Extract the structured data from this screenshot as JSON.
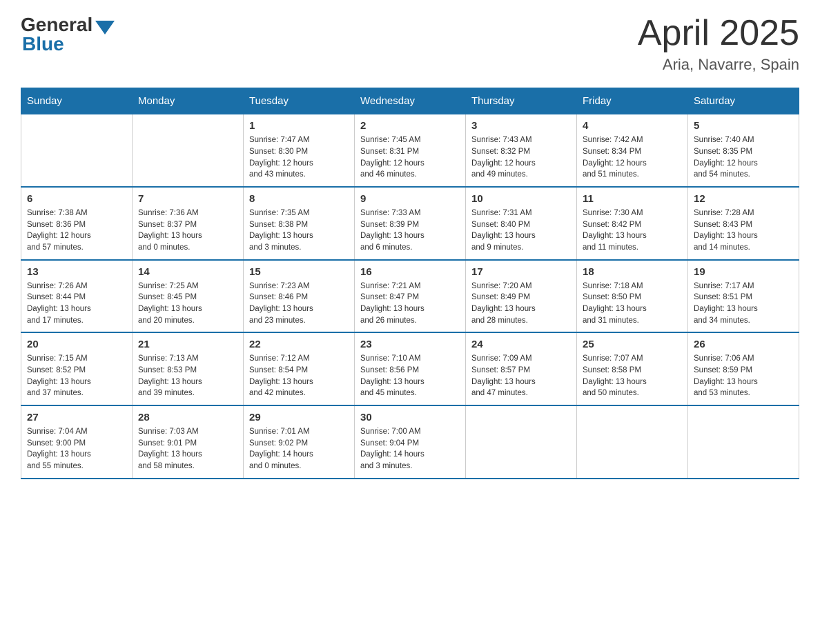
{
  "header": {
    "logo_general": "General",
    "logo_blue": "Blue",
    "month_title": "April 2025",
    "location": "Aria, Navarre, Spain"
  },
  "days_of_week": [
    "Sunday",
    "Monday",
    "Tuesday",
    "Wednesday",
    "Thursday",
    "Friday",
    "Saturday"
  ],
  "weeks": [
    [
      {
        "day": "",
        "info": ""
      },
      {
        "day": "",
        "info": ""
      },
      {
        "day": "1",
        "info": "Sunrise: 7:47 AM\nSunset: 8:30 PM\nDaylight: 12 hours\nand 43 minutes."
      },
      {
        "day": "2",
        "info": "Sunrise: 7:45 AM\nSunset: 8:31 PM\nDaylight: 12 hours\nand 46 minutes."
      },
      {
        "day": "3",
        "info": "Sunrise: 7:43 AM\nSunset: 8:32 PM\nDaylight: 12 hours\nand 49 minutes."
      },
      {
        "day": "4",
        "info": "Sunrise: 7:42 AM\nSunset: 8:34 PM\nDaylight: 12 hours\nand 51 minutes."
      },
      {
        "day": "5",
        "info": "Sunrise: 7:40 AM\nSunset: 8:35 PM\nDaylight: 12 hours\nand 54 minutes."
      }
    ],
    [
      {
        "day": "6",
        "info": "Sunrise: 7:38 AM\nSunset: 8:36 PM\nDaylight: 12 hours\nand 57 minutes."
      },
      {
        "day": "7",
        "info": "Sunrise: 7:36 AM\nSunset: 8:37 PM\nDaylight: 13 hours\nand 0 minutes."
      },
      {
        "day": "8",
        "info": "Sunrise: 7:35 AM\nSunset: 8:38 PM\nDaylight: 13 hours\nand 3 minutes."
      },
      {
        "day": "9",
        "info": "Sunrise: 7:33 AM\nSunset: 8:39 PM\nDaylight: 13 hours\nand 6 minutes."
      },
      {
        "day": "10",
        "info": "Sunrise: 7:31 AM\nSunset: 8:40 PM\nDaylight: 13 hours\nand 9 minutes."
      },
      {
        "day": "11",
        "info": "Sunrise: 7:30 AM\nSunset: 8:42 PM\nDaylight: 13 hours\nand 11 minutes."
      },
      {
        "day": "12",
        "info": "Sunrise: 7:28 AM\nSunset: 8:43 PM\nDaylight: 13 hours\nand 14 minutes."
      }
    ],
    [
      {
        "day": "13",
        "info": "Sunrise: 7:26 AM\nSunset: 8:44 PM\nDaylight: 13 hours\nand 17 minutes."
      },
      {
        "day": "14",
        "info": "Sunrise: 7:25 AM\nSunset: 8:45 PM\nDaylight: 13 hours\nand 20 minutes."
      },
      {
        "day": "15",
        "info": "Sunrise: 7:23 AM\nSunset: 8:46 PM\nDaylight: 13 hours\nand 23 minutes."
      },
      {
        "day": "16",
        "info": "Sunrise: 7:21 AM\nSunset: 8:47 PM\nDaylight: 13 hours\nand 26 minutes."
      },
      {
        "day": "17",
        "info": "Sunrise: 7:20 AM\nSunset: 8:49 PM\nDaylight: 13 hours\nand 28 minutes."
      },
      {
        "day": "18",
        "info": "Sunrise: 7:18 AM\nSunset: 8:50 PM\nDaylight: 13 hours\nand 31 minutes."
      },
      {
        "day": "19",
        "info": "Sunrise: 7:17 AM\nSunset: 8:51 PM\nDaylight: 13 hours\nand 34 minutes."
      }
    ],
    [
      {
        "day": "20",
        "info": "Sunrise: 7:15 AM\nSunset: 8:52 PM\nDaylight: 13 hours\nand 37 minutes."
      },
      {
        "day": "21",
        "info": "Sunrise: 7:13 AM\nSunset: 8:53 PM\nDaylight: 13 hours\nand 39 minutes."
      },
      {
        "day": "22",
        "info": "Sunrise: 7:12 AM\nSunset: 8:54 PM\nDaylight: 13 hours\nand 42 minutes."
      },
      {
        "day": "23",
        "info": "Sunrise: 7:10 AM\nSunset: 8:56 PM\nDaylight: 13 hours\nand 45 minutes."
      },
      {
        "day": "24",
        "info": "Sunrise: 7:09 AM\nSunset: 8:57 PM\nDaylight: 13 hours\nand 47 minutes."
      },
      {
        "day": "25",
        "info": "Sunrise: 7:07 AM\nSunset: 8:58 PM\nDaylight: 13 hours\nand 50 minutes."
      },
      {
        "day": "26",
        "info": "Sunrise: 7:06 AM\nSunset: 8:59 PM\nDaylight: 13 hours\nand 53 minutes."
      }
    ],
    [
      {
        "day": "27",
        "info": "Sunrise: 7:04 AM\nSunset: 9:00 PM\nDaylight: 13 hours\nand 55 minutes."
      },
      {
        "day": "28",
        "info": "Sunrise: 7:03 AM\nSunset: 9:01 PM\nDaylight: 13 hours\nand 58 minutes."
      },
      {
        "day": "29",
        "info": "Sunrise: 7:01 AM\nSunset: 9:02 PM\nDaylight: 14 hours\nand 0 minutes."
      },
      {
        "day": "30",
        "info": "Sunrise: 7:00 AM\nSunset: 9:04 PM\nDaylight: 14 hours\nand 3 minutes."
      },
      {
        "day": "",
        "info": ""
      },
      {
        "day": "",
        "info": ""
      },
      {
        "day": "",
        "info": ""
      }
    ]
  ]
}
